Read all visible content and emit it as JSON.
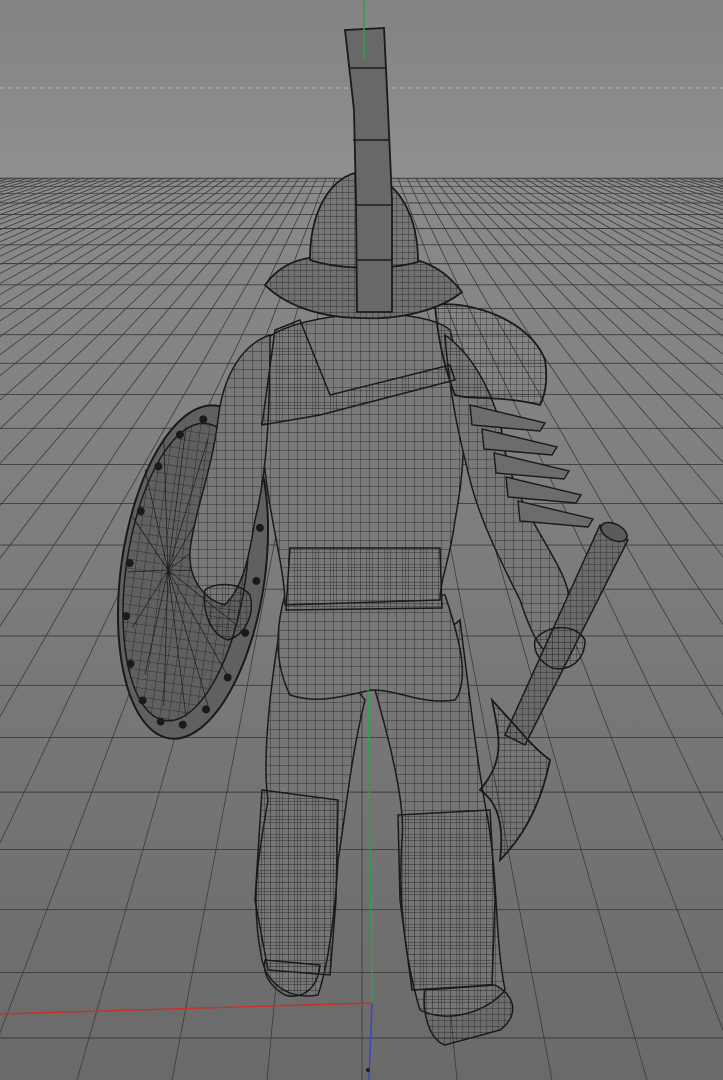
{
  "viewport": {
    "view": "perspective",
    "render_mode": "wireframe-on-shaded",
    "grid_visible": true,
    "axes_visible": [
      "x",
      "y",
      "z"
    ]
  },
  "colors": {
    "sky_top": "#838383",
    "sky_bottom": "#8f8f8f",
    "floor_far": "#8a8a8a",
    "floor_near": "#6a6a6a",
    "grid_line": "#3b3b3b",
    "mesh_fill": "#777777",
    "mesh_dark": "#5c5c5c",
    "wire": "#1f1f1f",
    "axis_x": "#c2332c",
    "axis_y": "#2aa34a",
    "axis_z": "#3345c9",
    "horizon_dash": "#b5b5b5"
  },
  "model": {
    "object": "gladiator-character",
    "parts": [
      "helmet-with-crest",
      "head",
      "torso",
      "strap",
      "shoulder-pauldron",
      "right-arm-armor",
      "left-arm",
      "round-shield",
      "hips",
      "left-leg-greave",
      "right-leg-greave",
      "boots",
      "axe-weapon"
    ]
  }
}
